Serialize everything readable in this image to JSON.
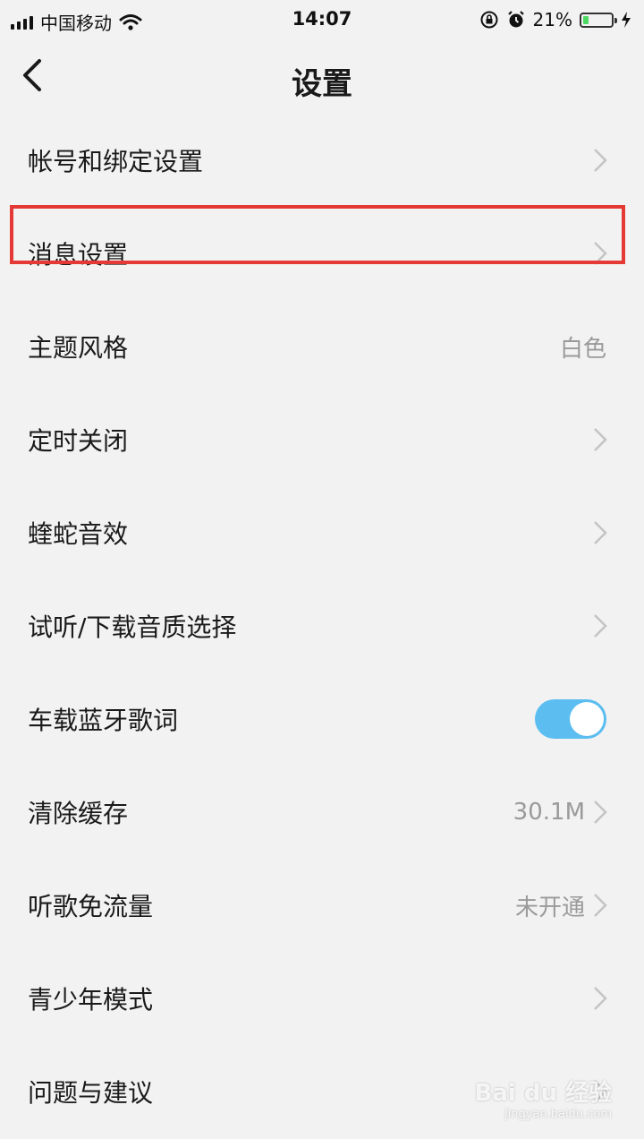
{
  "status_bar": {
    "carrier": "中国移动",
    "time": "14:07",
    "battery_percent": "21%",
    "battery_level": 0.21
  },
  "nav": {
    "title": "设置",
    "back_icon": "chevron-left-icon"
  },
  "settings": [
    {
      "label": "帐号和绑定设置",
      "value": "",
      "chevron": true
    },
    {
      "label": "消息设置",
      "value": "",
      "chevron": true
    },
    {
      "label": "主题风格",
      "value": "白色",
      "chevron": false,
      "highlighted": true
    },
    {
      "label": "定时关闭",
      "value": "",
      "chevron": true
    },
    {
      "label": "蝰蛇音效",
      "value": "",
      "chevron": true
    },
    {
      "label": "试听/下载音质选择",
      "value": "",
      "chevron": true
    },
    {
      "label": "车载蓝牙歌词",
      "toggle": true,
      "toggle_on": true
    },
    {
      "label": "清除缓存",
      "value": "30.1M",
      "chevron": true
    },
    {
      "label": "听歌免流量",
      "value": "未开通",
      "chevron": true
    },
    {
      "label": "青少年模式",
      "value": "",
      "chevron": true
    },
    {
      "label": "问题与建议",
      "value": "",
      "chevron": true
    }
  ],
  "colors": {
    "highlight": "#e53935",
    "toggle_on": "#5bbdf0",
    "background": "#f2f2f2"
  },
  "watermark": {
    "main": "Bai du 经验",
    "url": "jingyan.baidu.com"
  }
}
